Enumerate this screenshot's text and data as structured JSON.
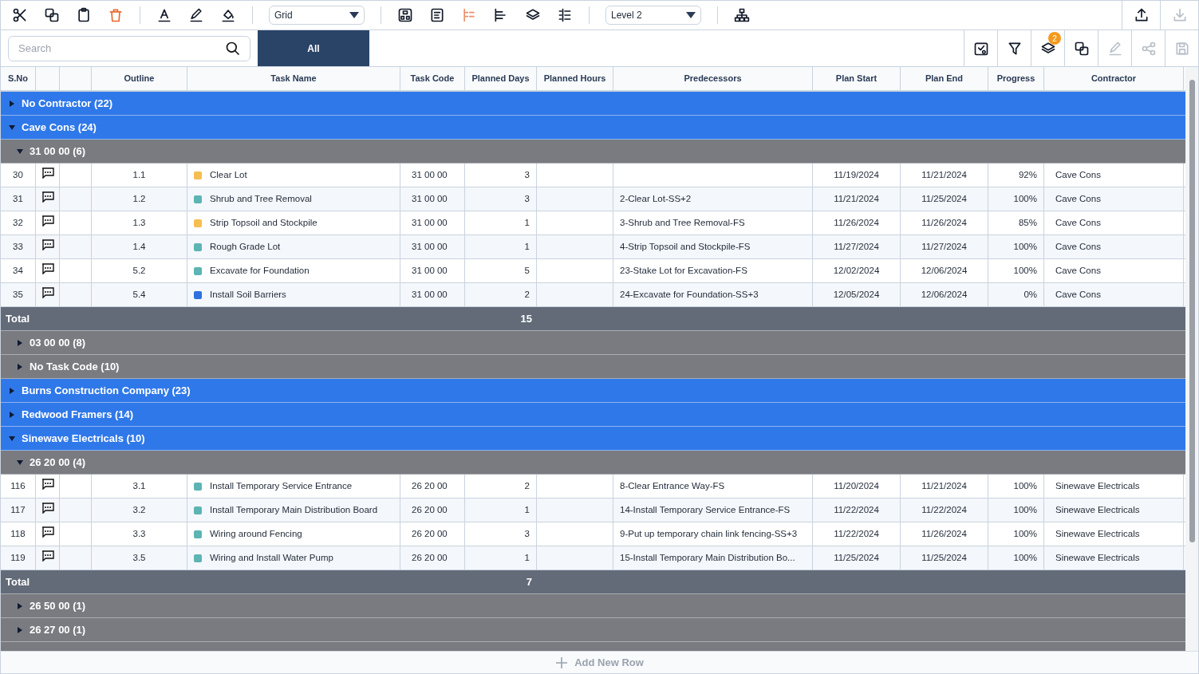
{
  "toolbar": {
    "left_tools": [
      {
        "kind": "scissors"
      },
      {
        "kind": "copy"
      },
      {
        "kind": "clipboard"
      },
      {
        "kind": "trash"
      },
      {
        "kind": "sep"
      },
      {
        "kind": "text-color"
      },
      {
        "kind": "pen"
      },
      {
        "kind": "fill"
      },
      {
        "kind": "sep"
      },
      {
        "kind": "dropdown",
        "value": "Grid"
      },
      {
        "kind": "sep"
      },
      {
        "kind": "diagram"
      },
      {
        "kind": "list"
      },
      {
        "kind": "tree"
      },
      {
        "kind": "bars"
      },
      {
        "kind": "layers"
      },
      {
        "kind": "indent"
      },
      {
        "kind": "sep"
      },
      {
        "kind": "dropdown",
        "value": "Level 2"
      },
      {
        "kind": "sep"
      },
      {
        "kind": "hierarchy"
      }
    ],
    "right_tools": [
      {
        "kind": "upload",
        "disabled": false
      },
      {
        "kind": "download",
        "disabled": true
      }
    ]
  },
  "search": {
    "placeholder": "Search"
  },
  "tabs": [
    {
      "label": "All",
      "selected": true
    }
  ],
  "actions": [
    {
      "kind": "calendar-check",
      "disabled": false
    },
    {
      "kind": "filter",
      "disabled": false
    },
    {
      "kind": "layers",
      "disabled": false,
      "badge": "2"
    },
    {
      "kind": "copy",
      "disabled": false
    },
    {
      "kind": "pen",
      "disabled": true
    },
    {
      "kind": "share",
      "disabled": true
    },
    {
      "kind": "save",
      "disabled": true
    }
  ],
  "table": {
    "columns": [
      "S.No",
      "",
      "",
      "Outline",
      "Task Name",
      "Task Code",
      "Planned Days",
      "Planned Hours",
      "Predecessors",
      "Plan Start",
      "Plan End",
      "Progress",
      "Contractor"
    ],
    "groups": [
      {
        "label": "No Contractor (22)",
        "expanded": false
      },
      {
        "label": "Cave Cons (24)",
        "expanded": true,
        "children": [
          {
            "label": "31 00 00 (6)",
            "expanded": true,
            "rows": [
              {
                "sno": "30",
                "outline": "1.1",
                "color": "#f5be4f",
                "task": "Clear Lot",
                "code": "31 00 00",
                "days": "3",
                "pred": "",
                "start": "11/19/2024",
                "end": "11/21/2024",
                "progress": "92%",
                "contractor": "Cave Cons"
              },
              {
                "sno": "31",
                "outline": "1.2",
                "color": "#5cb4b4",
                "task": "Shrub and Tree Removal",
                "code": "31 00 00",
                "days": "3",
                "pred": "2-Clear Lot-SS+2",
                "start": "11/21/2024",
                "end": "11/25/2024",
                "progress": "100%",
                "contractor": "Cave Cons"
              },
              {
                "sno": "32",
                "outline": "1.3",
                "color": "#f5be4f",
                "task": "Strip Topsoil and Stockpile",
                "code": "31 00 00",
                "days": "1",
                "pred": "3-Shrub and Tree Removal-FS",
                "start": "11/26/2024",
                "end": "11/26/2024",
                "progress": "85%",
                "contractor": "Cave Cons"
              },
              {
                "sno": "33",
                "outline": "1.4",
                "color": "#5cb4b4",
                "task": "Rough Grade Lot",
                "code": "31 00 00",
                "days": "1",
                "pred": "4-Strip Topsoil and Stockpile-FS",
                "start": "11/27/2024",
                "end": "11/27/2024",
                "progress": "100%",
                "contractor": "Cave Cons"
              },
              {
                "sno": "34",
                "outline": "5.2",
                "color": "#5cb4b4",
                "task": "Excavate for Foundation",
                "code": "31 00 00",
                "days": "5",
                "pred": "23-Stake Lot for Excavation-FS",
                "start": "12/02/2024",
                "end": "12/06/2024",
                "progress": "100%",
                "contractor": "Cave Cons"
              },
              {
                "sno": "35",
                "outline": "5.4",
                "color": "#2f6fe0",
                "task": "Install Soil Barriers",
                "code": "31 00 00",
                "days": "2",
                "pred": "24-Excavate for Foundation-SS+3",
                "start": "12/05/2024",
                "end": "12/06/2024",
                "progress": "0%",
                "contractor": "Cave Cons"
              }
            ],
            "total": {
              "label": "Total",
              "days": "15"
            }
          },
          {
            "label": "03 00 00 (8)",
            "expanded": false
          },
          {
            "label": "No Task Code (10)",
            "expanded": false
          }
        ]
      },
      {
        "label": "Burns Construction Company (23)",
        "expanded": false
      },
      {
        "label": "Redwood Framers (14)",
        "expanded": false
      },
      {
        "label": "Sinewave Electricals (10)",
        "expanded": true,
        "children": [
          {
            "label": "26 20 00 (4)",
            "expanded": true,
            "rows": [
              {
                "sno": "116",
                "outline": "3.1",
                "color": "#5cb4b4",
                "task": "Install Temporary Service Entrance",
                "code": "26 20 00",
                "days": "2",
                "pred": "8-Clear Entrance Way-FS",
                "start": "11/20/2024",
                "end": "11/21/2024",
                "progress": "100%",
                "contractor": "Sinewave Electricals"
              },
              {
                "sno": "117",
                "outline": "3.2",
                "color": "#5cb4b4",
                "task": "Install Temporary Main Distribution Board",
                "code": "26 20 00",
                "days": "1",
                "pred": "14-Install Temporary Service Entrance-FS",
                "start": "11/22/2024",
                "end": "11/22/2024",
                "progress": "100%",
                "contractor": "Sinewave Electricals"
              },
              {
                "sno": "118",
                "outline": "3.3",
                "color": "#5cb4b4",
                "task": "Wiring around Fencing",
                "code": "26 20 00",
                "days": "3",
                "pred": "9-Put up temporary chain link fencing-SS+3",
                "start": "11/22/2024",
                "end": "11/26/2024",
                "progress": "100%",
                "contractor": "Sinewave Electricals"
              },
              {
                "sno": "119",
                "outline": "3.5",
                "color": "#5cb4b4",
                "task": "Wiring and Install Water Pump",
                "code": "26 20 00",
                "days": "1",
                "pred": "15-Install Temporary Main Distribution Bo...",
                "start": "11/25/2024",
                "end": "11/25/2024",
                "progress": "100%",
                "contractor": "Sinewave Electricals"
              }
            ],
            "total": {
              "label": "Total",
              "days": "7"
            }
          },
          {
            "label": "26 50 00 (1)",
            "expanded": false
          },
          {
            "label": "26 27 00 (1)",
            "expanded": false
          }
        ]
      }
    ]
  },
  "footer": {
    "add_row": "Add New Row"
  }
}
